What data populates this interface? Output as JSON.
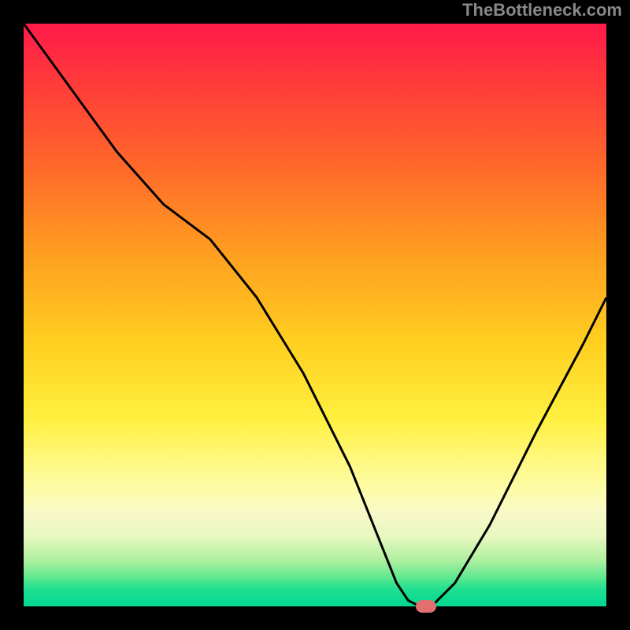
{
  "watermark": "TheBottleneck.com",
  "chart_data": {
    "type": "line",
    "title": "",
    "xlabel": "",
    "ylabel": "",
    "xlim": [
      0,
      100
    ],
    "ylim": [
      0,
      100
    ],
    "background_gradient": {
      "top": "#ff1a4a",
      "middle": "#ffd020",
      "bottom": "#00d890"
    },
    "series": [
      {
        "name": "bottleneck-curve",
        "color": "#000000",
        "x": [
          0,
          8,
          16,
          24,
          32,
          40,
          48,
          56,
          60,
          64,
          66,
          68,
          70,
          74,
          80,
          88,
          96,
          100
        ],
        "values": [
          100,
          89,
          78,
          69,
          63,
          53,
          40,
          24,
          14,
          4,
          1,
          0,
          0,
          4,
          14,
          30,
          45,
          53
        ]
      }
    ],
    "marker": {
      "x": 69,
      "y": 0,
      "color": "#e07070"
    },
    "grid": false,
    "legend": false
  }
}
